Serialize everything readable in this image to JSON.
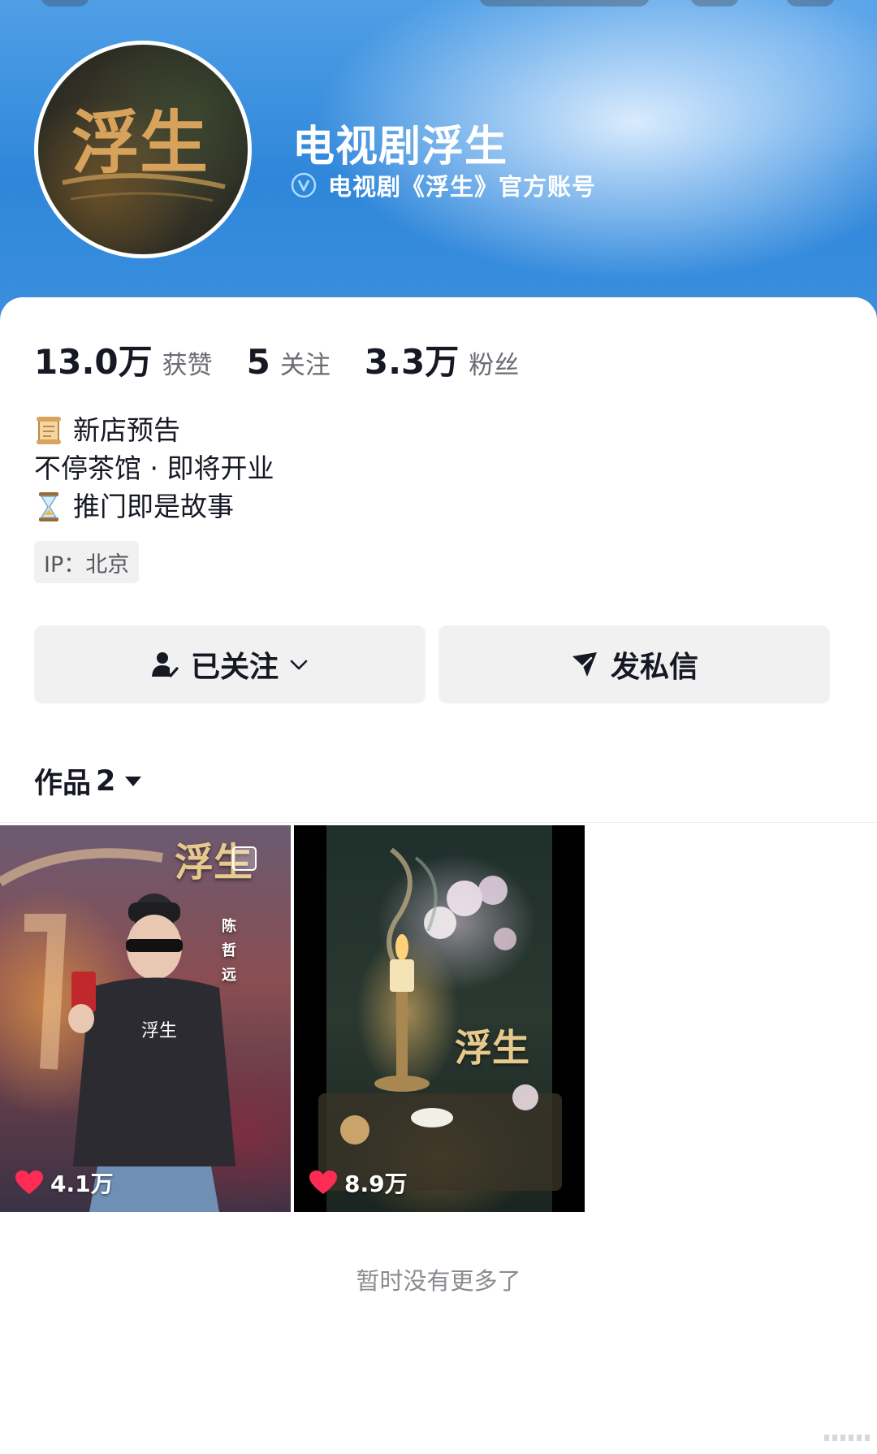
{
  "profile": {
    "name": "电视剧浮生",
    "verification": "电视剧《浮生》官方账号",
    "avatar_text": "浮生"
  },
  "stats": [
    {
      "value": "13.0万",
      "label": "获赞"
    },
    {
      "value": "5",
      "label": "关注"
    },
    {
      "value": "3.3万",
      "label": "粉丝"
    }
  ],
  "bio": {
    "line1": "新店预告",
    "line2": "不停茶馆 · 即将开业",
    "line3": "推门即是故事",
    "line1_icon": "scroll-emoji",
    "line3_icon": "hourglass-emoji"
  },
  "ip": "IP：北京",
  "actions": {
    "follow_label": "已关注",
    "message_label": "发私信"
  },
  "tabs": {
    "works_label": "作品",
    "works_count": "2"
  },
  "works": [
    {
      "likes": "4.1万",
      "overlay_text": "浮生",
      "cast_text": "陈哲远",
      "accent": "#8a4e52"
    },
    {
      "likes": "8.9万",
      "overlay_text": "浮生",
      "accent": "#2a3830"
    }
  ],
  "footer": {
    "end_text": "暂时没有更多了"
  },
  "colors": {
    "header_blue": "#2f86da",
    "like_red": "#fe2c55",
    "button_bg": "#f1f1f2"
  }
}
